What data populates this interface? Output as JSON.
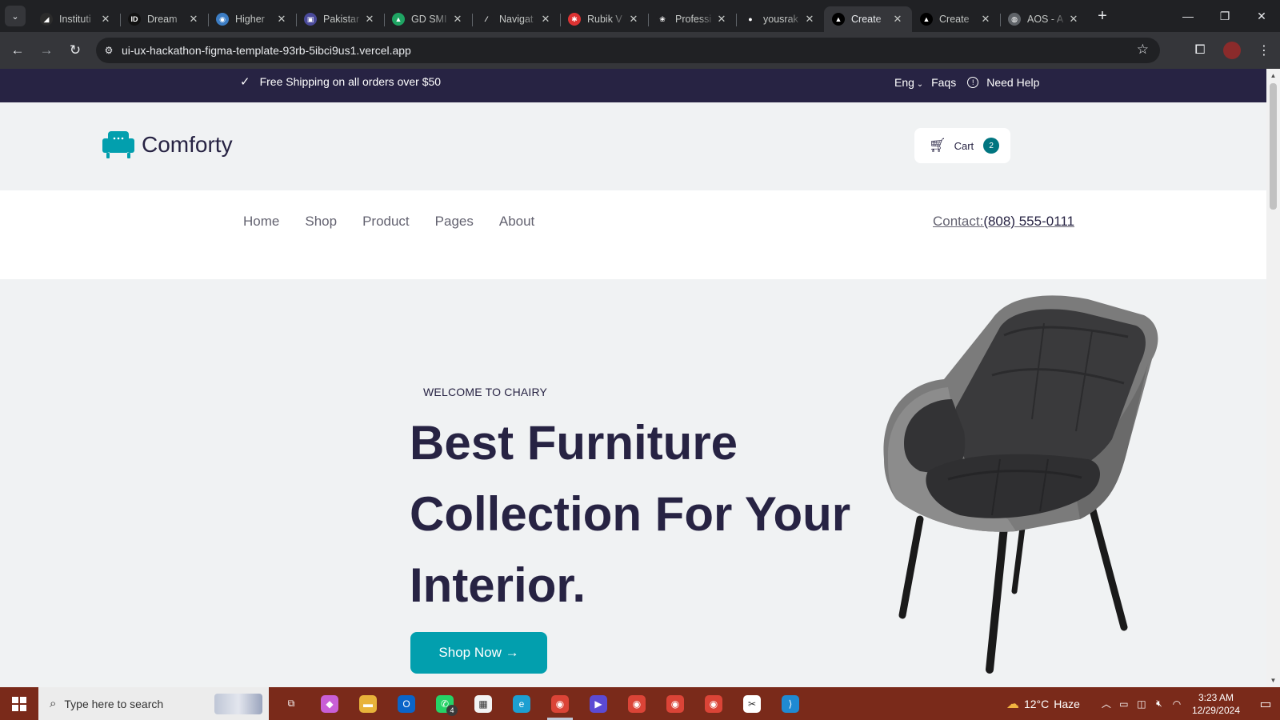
{
  "browser": {
    "tabs": [
      {
        "label": "Instituti",
        "fav_color": "#2b2b2b",
        "fav_glyph": "◢"
      },
      {
        "label": "Dream",
        "fav_color": "#111111",
        "fav_glyph": "ID"
      },
      {
        "label": "Higher",
        "fav_color": "#3c7dc4",
        "fav_glyph": "◉"
      },
      {
        "label": "Pakistar",
        "fav_color": "#4a4a9a",
        "fav_glyph": "▣"
      },
      {
        "label": "GD SMI",
        "fav_color": "#1fa463",
        "fav_glyph": "▲"
      },
      {
        "label": "Navigat",
        "fav_color": "#202124",
        "fav_glyph": "⁄"
      },
      {
        "label": "Rubik V",
        "fav_color": "#d33",
        "fav_glyph": "✱"
      },
      {
        "label": "Professi",
        "fav_color": "#202124",
        "fav_glyph": "❀"
      },
      {
        "label": "yousrak",
        "fav_color": "#202124",
        "fav_glyph": "●"
      },
      {
        "label": "Create",
        "fav_color": "#000000",
        "fav_glyph": "▲"
      },
      {
        "label": "Create",
        "fav_color": "#000000",
        "fav_glyph": "▲"
      },
      {
        "label": "AOS - A",
        "fav_color": "#5f6368",
        "fav_glyph": "◍"
      }
    ],
    "active_tab_index": 9,
    "url": "ui-ux-hackathon-figma-template-93rb-5ibci9us1.vercel.app"
  },
  "page": {
    "topbar": {
      "shipping_text": "Free Shipping on all orders over $50",
      "language": "Eng",
      "faqs": "Faqs",
      "need_help": "Need Help"
    },
    "header": {
      "logo_text": "Comforty",
      "cart_label": "Cart",
      "cart_count": "2"
    },
    "nav": {
      "links": [
        "Home",
        "Shop",
        "Product",
        "Pages",
        "About"
      ],
      "contact_label": "Contact:",
      "contact_phone": "(808) 555-0111"
    },
    "hero": {
      "eyebrow": "WELCOME TO CHAIRY",
      "headline": [
        "Best Furniture",
        "Collection For Your",
        "Interior."
      ],
      "cta": "Shop Now →"
    },
    "colors": {
      "topbar_bg": "#272343",
      "accent": "#029fae",
      "badge": "#007580",
      "heading": "#272343"
    }
  },
  "taskbar": {
    "search_placeholder": "Type here to search",
    "apps": [
      {
        "name": "task-view-icon",
        "color": "transparent",
        "glyph": "⧉"
      },
      {
        "name": "copilot-icon",
        "color": "#c95fd6",
        "glyph": "◆"
      },
      {
        "name": "file-explorer-icon",
        "color": "#e8b33a",
        "glyph": "▬"
      },
      {
        "name": "outlook-icon",
        "color": "#0a64c8",
        "glyph": "O"
      },
      {
        "name": "whatsapp-icon",
        "color": "#25d366",
        "glyph": "✆"
      },
      {
        "name": "microsoft-store-icon",
        "color": "#f3f3f3",
        "glyph": "▦"
      },
      {
        "name": "edge-icon",
        "color": "#1c9fd1",
        "glyph": "e"
      },
      {
        "name": "chrome-icon",
        "color": "#db4437",
        "glyph": "◉"
      },
      {
        "name": "app-blue-icon",
        "color": "#5b4ad4",
        "glyph": "▶"
      },
      {
        "name": "chrome-profile-icon",
        "color": "#db4437",
        "glyph": "◉"
      },
      {
        "name": "chrome-profile-2-icon",
        "color": "#db4437",
        "glyph": "◉"
      },
      {
        "name": "chrome-profile-3-icon",
        "color": "#db4437",
        "glyph": "◉"
      },
      {
        "name": "capcut-icon",
        "color": "#ffffff",
        "glyph": "✂"
      },
      {
        "name": "vscode-icon",
        "color": "#1f8ad2",
        "glyph": "⟩"
      }
    ],
    "whatsapp_badge": "4",
    "weather_temp": "12°C",
    "weather_desc": "Haze",
    "time": "3:23 AM",
    "date": "12/29/2024"
  }
}
